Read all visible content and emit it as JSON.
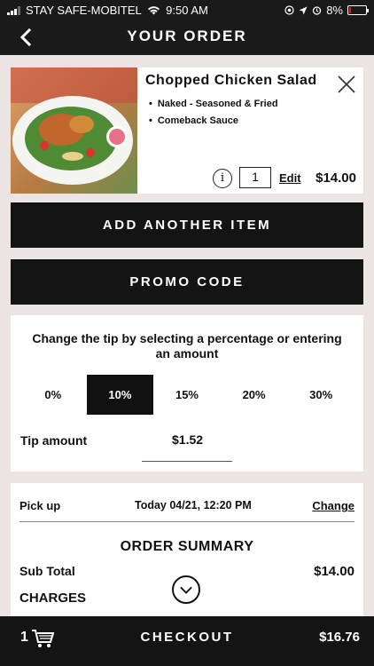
{
  "status_bar": {
    "carrier": "STAY SAFE-MOBITEL",
    "time": "9:50 AM",
    "battery": "8%"
  },
  "header": {
    "title": "YOUR ORDER"
  },
  "item": {
    "name": "Chopped Chicken Salad",
    "modifiers": [
      "Naked - Seasoned & Fried",
      "Comeback Sauce"
    ],
    "info_glyph": "i",
    "quantity": "1",
    "edit_label": "Edit",
    "price": "$14.00"
  },
  "buttons": {
    "add_another": "ADD ANOTHER ITEM",
    "promo_code": "PROMO CODE"
  },
  "tip": {
    "prompt": "Change the tip by selecting a percentage or entering an amount",
    "options": [
      "0%",
      "10%",
      "15%",
      "20%",
      "30%"
    ],
    "selected": "10%",
    "amount_label": "Tip amount",
    "amount": "$1.52"
  },
  "summary": {
    "pickup_label": "Pick up",
    "pickup_time": "Today 04/21, 12:20 PM",
    "change_label": "Change",
    "title": "ORDER SUMMARY",
    "subtotal_label": "Sub Total",
    "subtotal": "$14.00",
    "charges_label": "CHARGES"
  },
  "checkout": {
    "count": "1",
    "label": "CHECKOUT",
    "total": "$16.76"
  },
  "colors": {
    "bar": "#141414",
    "background": "#ebe4e3",
    "selected_tip": "#111111",
    "battery_low": "#e02020"
  },
  "icons": [
    "back-arrow-icon",
    "close-icon",
    "info-icon",
    "chevron-down-icon",
    "cart-icon",
    "wifi-icon",
    "location-icon",
    "alarm-icon",
    "signal-icon",
    "battery-icon"
  ]
}
